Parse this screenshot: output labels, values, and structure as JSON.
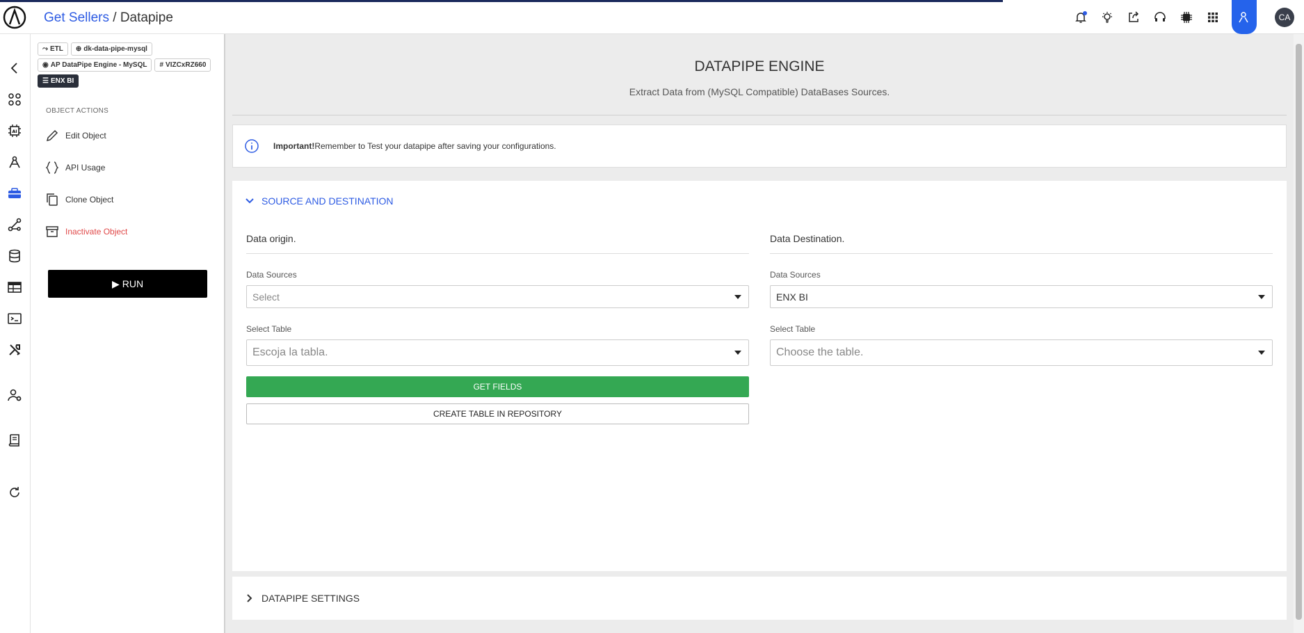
{
  "header": {
    "breadcrumb_link": "Get Sellers",
    "breadcrumb_sep": " / ",
    "breadcrumb_current": "Datapipe",
    "avatar_initials": "CA",
    "icons": [
      "bell-icon",
      "lightbulb-icon",
      "share-icon",
      "headset-icon",
      "chip-icon",
      "apps-grid-icon",
      "user-admin-icon"
    ]
  },
  "rail": {
    "icons": [
      "back-arrow-icon",
      "dashboard-icon",
      "ai-chip-icon",
      "compass-icon",
      "toolbox-icon",
      "nodes-icon",
      "database-icon",
      "table-icon",
      "terminal-icon",
      "tools-icon",
      "user-settings-icon",
      "book-icon",
      "refresh-icon"
    ]
  },
  "sidebar": {
    "tags": [
      {
        "label": "ETL"
      },
      {
        "label": "dk-data-pipe-mysql"
      },
      {
        "label": "AP DataPipe Engine - MySQL"
      },
      {
        "label": "VIZCxRZ660"
      },
      {
        "label": "ENX BI"
      }
    ],
    "section_title": "OBJECT ACTIONS",
    "actions": [
      {
        "label": "Edit Object"
      },
      {
        "label": "API Usage"
      },
      {
        "label": "Clone Object"
      },
      {
        "label": "Inactivate Object"
      }
    ],
    "run_label": "RUN"
  },
  "main": {
    "title": "DATAPIPE ENGINE",
    "subtitle": "Extract Data from (MySQL Compatible) DataBases Sources.",
    "alert_bold": "Important!",
    "alert_text": " Remember to Test your datapipe after saving your configurations.",
    "section1_title": "SOURCE AND DESTINATION",
    "origin": {
      "title": "Data origin.",
      "sources_label": "Data Sources",
      "sources_value": "Select",
      "table_label": "Select Table",
      "table_value": "Escoja la tabla.",
      "get_fields": "GET FIELDS",
      "create_table": "CREATE TABLE IN REPOSITORY"
    },
    "destination": {
      "title": "Data Destination.",
      "sources_label": "Data Sources",
      "sources_value": "ENX BI",
      "table_label": "Select Table",
      "table_value": "Choose the table."
    },
    "section2_title": "DATAPIPE SETTINGS"
  },
  "colors": {
    "accent": "#2d5be3",
    "run": "#000000",
    "get_fields": "#34a853",
    "danger": "#e04848"
  }
}
